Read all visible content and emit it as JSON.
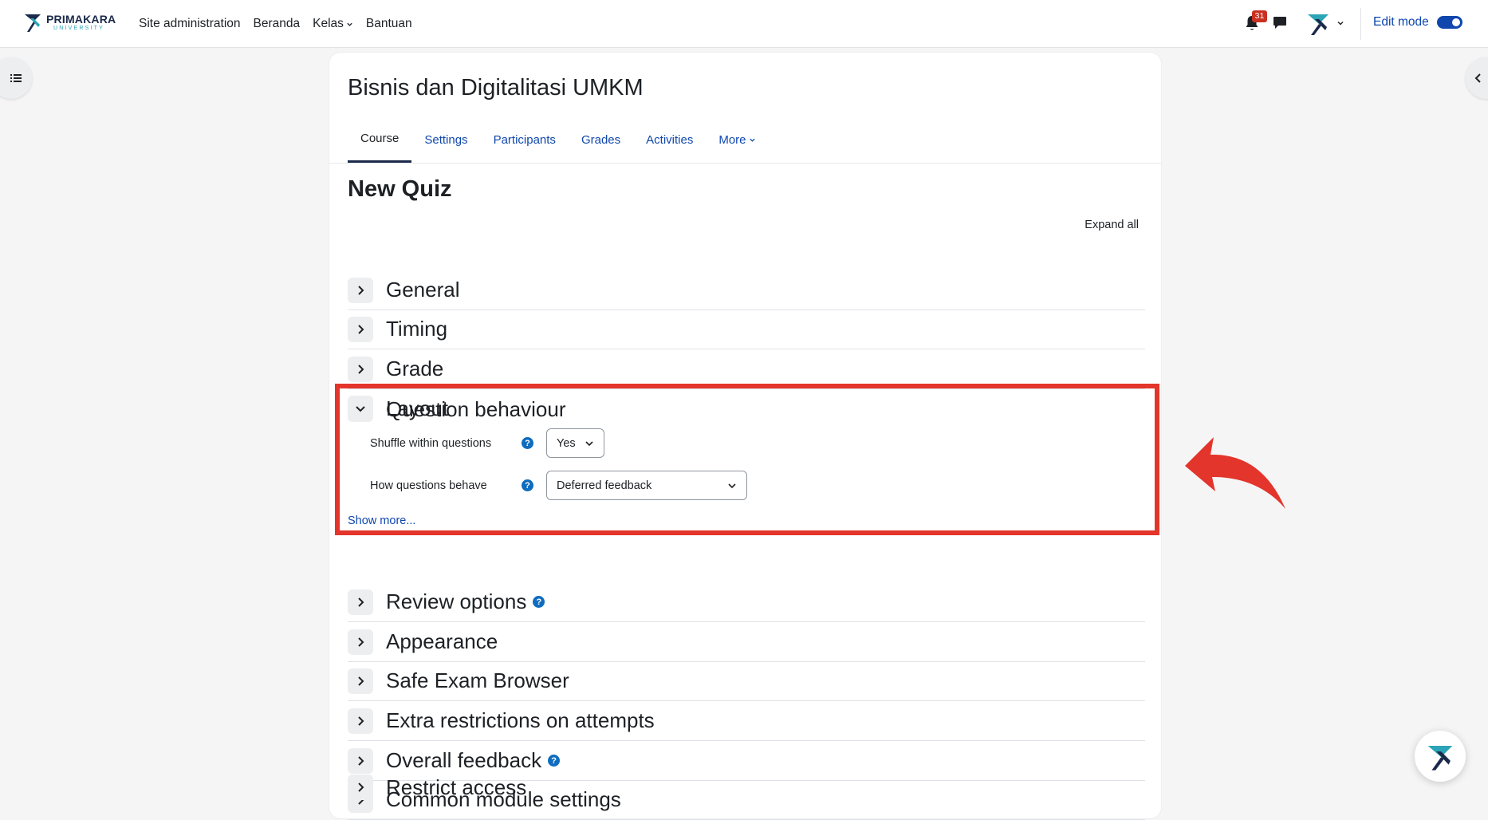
{
  "brand": {
    "name": "PRIMAKARA",
    "sub": "UNIVERSITY"
  },
  "nav": {
    "items": [
      {
        "label": "Site administration"
      },
      {
        "label": "Beranda"
      },
      {
        "label": "Kelas"
      },
      {
        "label": "Bantuan"
      }
    ],
    "notifications_count": "31",
    "edit_mode_label": "Edit mode"
  },
  "course": {
    "title": "Bisnis dan Digitalitasi UMKM",
    "tabs": [
      {
        "label": "Course"
      },
      {
        "label": "Settings"
      },
      {
        "label": "Participants"
      },
      {
        "label": "Grades"
      },
      {
        "label": "Activities"
      },
      {
        "label": "More"
      }
    ]
  },
  "page": {
    "title": "New Quiz",
    "expand_all": "Expand all",
    "sections_top": [
      {
        "label": "General"
      },
      {
        "label": "Timing"
      },
      {
        "label": "Grade"
      },
      {
        "label": "Layout"
      }
    ],
    "question_behaviour": {
      "label": "Question behaviour",
      "shuffle_label": "Shuffle within questions",
      "shuffle_value": "Yes",
      "behave_label": "How questions behave",
      "behave_value": "Deferred feedback",
      "show_more": "Show more..."
    },
    "sections_bottom": [
      {
        "label": "Review options"
      },
      {
        "label": "Appearance"
      },
      {
        "label": "Safe Exam Browser"
      },
      {
        "label": "Extra restrictions on attempts"
      },
      {
        "label": "Overall feedback"
      },
      {
        "label": "Common module settings"
      },
      {
        "label": "Restrict access"
      }
    ]
  },
  "colors": {
    "link": "#0f47ad",
    "highlight": "#e3352b",
    "badge": "#ca3120"
  }
}
